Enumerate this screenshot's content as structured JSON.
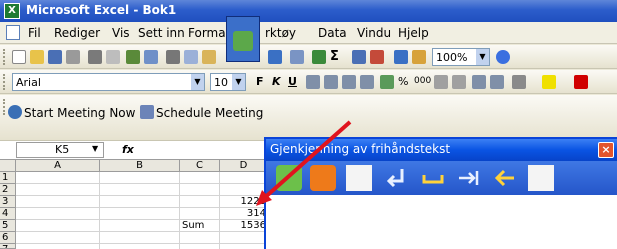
{
  "window": {
    "title": "Microsoft Excel - Bok1",
    "app_icon": "X"
  },
  "menu": [
    "Fil",
    "Rediger",
    "Vis",
    "Sett inn",
    "Format",
    "Verktøy",
    "Data",
    "Vindu",
    "Hjelp"
  ],
  "menu_visible": {
    "format": "Forma",
    "tools": "rktøy"
  },
  "standard_toolbar": {
    "zoom": "100%",
    "sigma": "Σ"
  },
  "format_toolbar": {
    "font": "Arial",
    "size": "10",
    "bold": "F",
    "italic": "K",
    "underline": "U",
    "percent": "%",
    "thousands": "000"
  },
  "meeting_toolbar": {
    "start_meeting": "Start Meeting Now",
    "schedule_meeting": "Schedule Meeting"
  },
  "formula_bar": {
    "name_box": "K5",
    "fx": "fx"
  },
  "columns": [
    "A",
    "B",
    "C",
    "D"
  ],
  "rows": [
    "1",
    "2",
    "3",
    "4",
    "5",
    "6",
    "7"
  ],
  "cells": {
    "D3": "1222",
    "D4": "314",
    "C5": "Sum",
    "D5": "1536"
  },
  "handwriting_window": {
    "title": "Gjenkjenning av frihåndstekst",
    "close": "×"
  },
  "colors": {
    "titlebar": "#2c5dcb",
    "handwriting_title": "#0a54e3",
    "arrow": "#e0141e"
  }
}
